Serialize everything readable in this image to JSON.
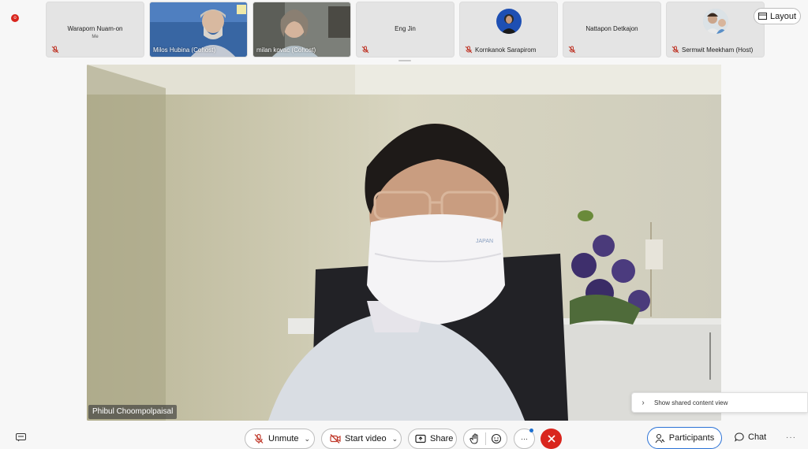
{
  "recording": {
    "dot_label": "o"
  },
  "participants_strip": [
    {
      "name": "Waraporn Nuam-on",
      "sub": "Me",
      "muted": true,
      "kind": "no-video"
    },
    {
      "name": "Milos Hubina (Cohost)",
      "muted": false,
      "kind": "video"
    },
    {
      "name": "milan kovac (Cohost)",
      "muted": false,
      "kind": "video"
    },
    {
      "name": "Eng Jin",
      "muted": true,
      "kind": "no-video"
    },
    {
      "name": "Kornkanok Sarapirom",
      "muted": true,
      "kind": "avatar"
    },
    {
      "name": "Nattapon Detkajon",
      "muted": true,
      "kind": "no-video"
    },
    {
      "name": "Sermwit Meekham (Host)",
      "muted": true,
      "kind": "avatar"
    }
  ],
  "layout_button": {
    "label": "Layout"
  },
  "main_speaker": {
    "name": "Phibul Choompolpaisal"
  },
  "shared_content": {
    "label": "Show shared content view"
  },
  "toolbar": {
    "unmute": "Unmute",
    "start_video": "Start video",
    "share": "Share",
    "more": "···",
    "participants": "Participants",
    "chat": "Chat",
    "overflow": "···"
  },
  "colors": {
    "end_call": "#d9251d",
    "accent": "#2b72d6",
    "muted_icon": "#c0392b"
  }
}
